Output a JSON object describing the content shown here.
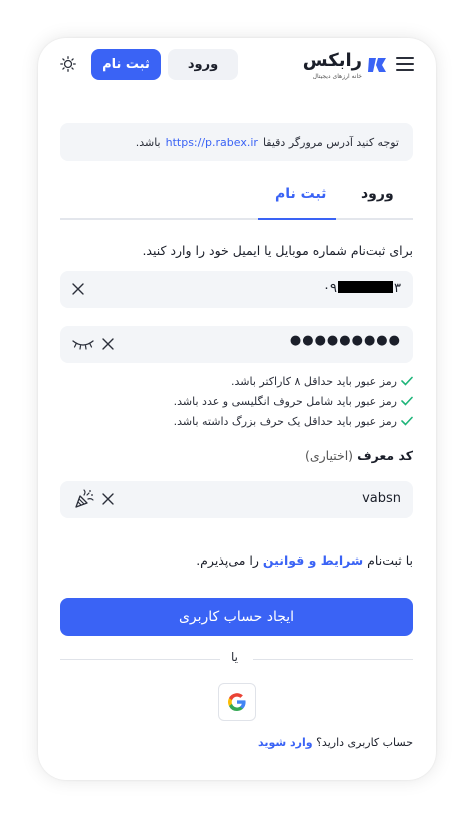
{
  "header": {
    "logo_text": "رابکس",
    "logo_sub": "خانه ارزهای دیجیتال",
    "login_label": "ورود",
    "signup_label": "ثبت نام",
    "brand_color": "#3a63f5"
  },
  "notice": {
    "prefix": "توجه کنید آدرس مرورگر دقیقا",
    "url": "https://p.rabex.ir",
    "suffix": "باشد."
  },
  "tabs": [
    {
      "label": "ورود",
      "active": false
    },
    {
      "label": "ثبت نام",
      "active": true
    }
  ],
  "form": {
    "instruction": "برای ثبت‌نام شماره موبایل یا ایمیل خود را وارد کنید.",
    "phone": {
      "prefix": "۰۹",
      "suffix": "۳"
    },
    "password": {
      "value": "●●●●●●●●●"
    },
    "rules": [
      "رمز عبور باید حداقل ۸ کاراکتر باشد.",
      "رمز عبور باید شامل حروف انگلیسی و عدد باشد.",
      "رمز عبور باید حداقل یک حرف بزرگ داشته باشد."
    ],
    "referral": {
      "label": "کد معرف",
      "optional": "(اختیاری)",
      "value": "vabsn"
    },
    "terms": {
      "prefix": "با ثبت‌نام",
      "link": "شرایط و قوانین",
      "suffix": "را می‌پذیرم."
    },
    "submit_label": "ایجاد حساب کاربری"
  },
  "divider_text": "یا",
  "footer": {
    "question": "حساب کاربری دارید؟",
    "link": "وارد شوید"
  }
}
